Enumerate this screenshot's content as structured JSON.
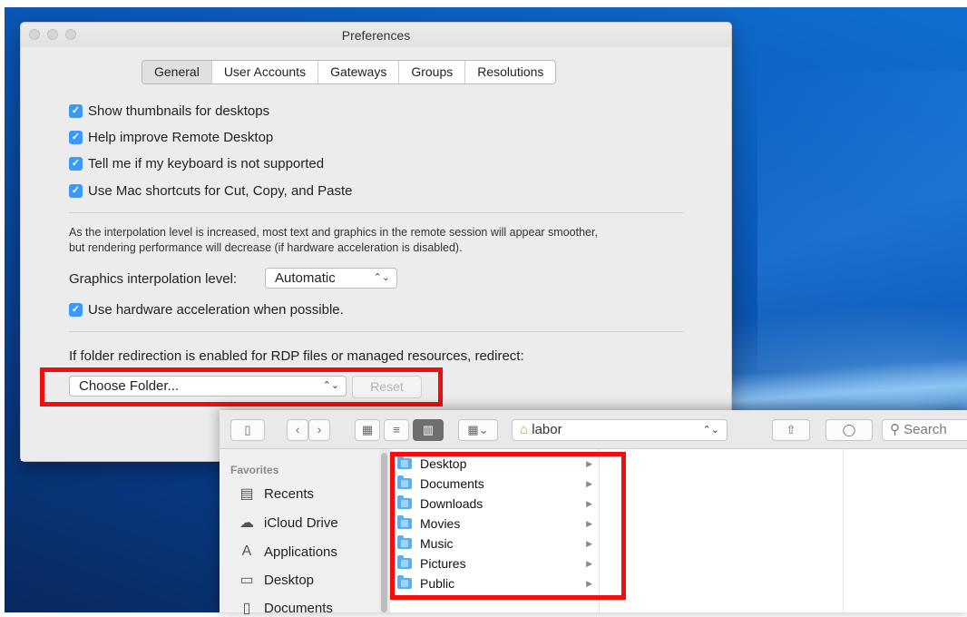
{
  "preferences": {
    "title": "Preferences",
    "tabs": [
      "General",
      "User Accounts",
      "Gateways",
      "Groups",
      "Resolutions"
    ],
    "selected_tab": "General",
    "checkboxes": [
      {
        "label": "Show thumbnails for desktops",
        "checked": true
      },
      {
        "label": "Help improve Remote Desktop",
        "checked": true
      },
      {
        "label": "Tell me if my keyboard is not supported",
        "checked": true
      },
      {
        "label": "Use Mac shortcuts for Cut, Copy, and Paste",
        "checked": true
      }
    ],
    "interpolation_note_line1": "As the interpolation level is increased, most text and graphics in the remote session will appear smoother,",
    "interpolation_note_line2": "but rendering performance will decrease (if hardware acceleration is disabled).",
    "interpolation_label": "Graphics interpolation level:",
    "interpolation_value": "Automatic",
    "hw_accel_label": "Use hardware acceleration when possible.",
    "hw_accel_checked": true,
    "redirect_label": "If folder redirection is enabled for RDP files or managed resources, redirect:",
    "folder_popup_value": "Choose Folder...",
    "reset_label": "Reset"
  },
  "finder": {
    "path_label": "labor",
    "search_placeholder": "Search",
    "sidebar_heading": "Favorites",
    "sidebar_items": [
      {
        "label": "Recents",
        "icon": "recents-icon"
      },
      {
        "label": "iCloud Drive",
        "icon": "cloud-icon"
      },
      {
        "label": "Applications",
        "icon": "applications-icon"
      },
      {
        "label": "Desktop",
        "icon": "desktop-icon"
      },
      {
        "label": "Documents",
        "icon": "documents-icon"
      }
    ],
    "folders": [
      "Desktop",
      "Documents",
      "Downloads",
      "Movies",
      "Music",
      "Pictures",
      "Public"
    ]
  },
  "colors": {
    "highlight_box": "#f00e0e",
    "checkbox_blue": "#3b99fc",
    "folder_blue": "#5ab0ee"
  }
}
